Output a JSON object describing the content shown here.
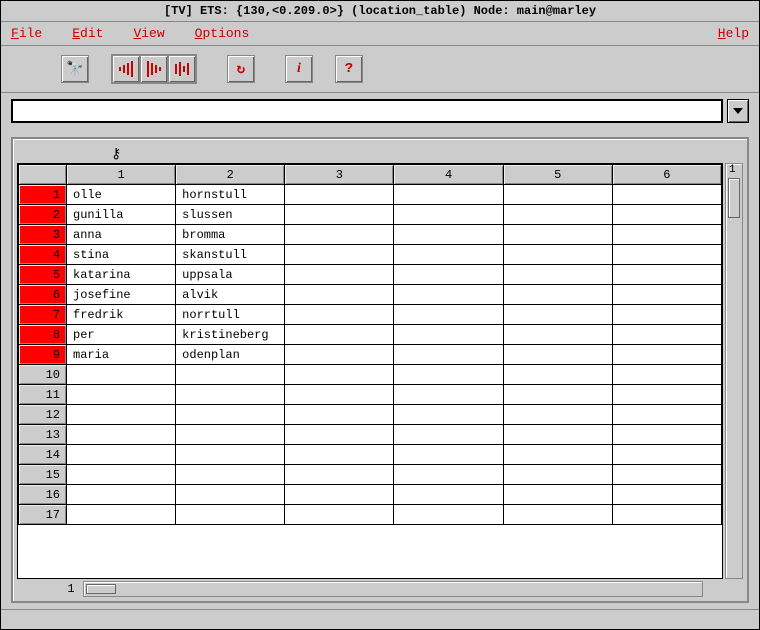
{
  "titlebar": "[TV]  ETS: {130,<0.209.0>}  (location_table)   Node: main@marley",
  "menu": {
    "file": "File",
    "edit": "Edit",
    "view": "View",
    "options": "Options",
    "help": "Help"
  },
  "toolbar": {
    "search_tip": "Search",
    "refresh_tip": "Refresh",
    "info_tip": "Info",
    "help_tip": "Help"
  },
  "input": {
    "value": "",
    "placeholder": ""
  },
  "key_symbol": "⚷",
  "columns": [
    "1",
    "2",
    "3",
    "4",
    "5",
    "6"
  ],
  "rows": [
    {
      "n": "1",
      "c1": "olle",
      "c2": "hornstull",
      "filled": true
    },
    {
      "n": "2",
      "c1": "gunilla",
      "c2": "slussen",
      "filled": true
    },
    {
      "n": "3",
      "c1": "anna",
      "c2": "bromma",
      "filled": true
    },
    {
      "n": "4",
      "c1": "stina",
      "c2": "skanstull",
      "filled": true
    },
    {
      "n": "5",
      "c1": "katarina",
      "c2": "uppsala",
      "filled": true
    },
    {
      "n": "6",
      "c1": "josefine",
      "c2": "alvik",
      "filled": true
    },
    {
      "n": "7",
      "c1": "fredrik",
      "c2": "norrtull",
      "filled": true
    },
    {
      "n": "8",
      "c1": "per",
      "c2": "kristineberg",
      "filled": true
    },
    {
      "n": "9",
      "c1": "maria",
      "c2": "odenplan",
      "filled": true
    },
    {
      "n": "10",
      "c1": "",
      "c2": "",
      "filled": false
    },
    {
      "n": "11",
      "c1": "",
      "c2": "",
      "filled": false
    },
    {
      "n": "12",
      "c1": "",
      "c2": "",
      "filled": false
    },
    {
      "n": "13",
      "c1": "",
      "c2": "",
      "filled": false
    },
    {
      "n": "14",
      "c1": "",
      "c2": "",
      "filled": false
    },
    {
      "n": "15",
      "c1": "",
      "c2": "",
      "filled": false
    },
    {
      "n": "16",
      "c1": "",
      "c2": "",
      "filled": false
    },
    {
      "n": "17",
      "c1": "",
      "c2": "",
      "filled": false
    }
  ],
  "vscroll_label": "1",
  "hscroll_label": "1"
}
